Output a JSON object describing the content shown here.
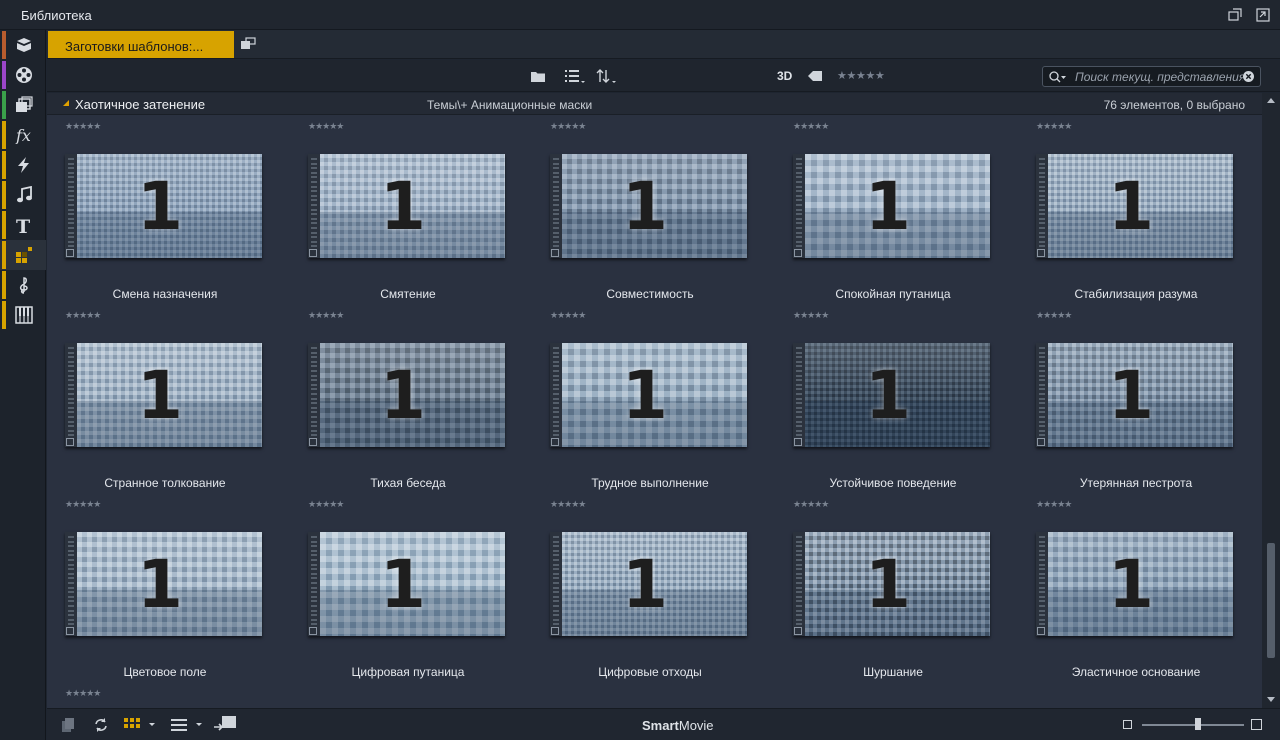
{
  "app": {
    "title": "Библиотека"
  },
  "sidebar": {
    "items": [
      {
        "icon": "box-icon",
        "color": "#b85c2e"
      },
      {
        "icon": "film-reel-icon",
        "color": "#9b46c8"
      },
      {
        "icon": "clips-stack-icon",
        "color": "#3aa04a"
      },
      {
        "icon": "fx-icon",
        "color": "#d7a300"
      },
      {
        "icon": "transition-bolt-icon",
        "color": "#d7a300"
      },
      {
        "icon": "music-note-icon",
        "color": "#d7a300"
      },
      {
        "icon": "title-text-icon",
        "color": "#d7a300"
      },
      {
        "icon": "template-grid-icon",
        "color": "#d7a300",
        "active": true
      },
      {
        "icon": "treble-clef-icon",
        "color": "#d7a300"
      },
      {
        "icon": "piano-icon",
        "color": "#d7a300"
      }
    ]
  },
  "tab": {
    "label": "Заготовки шаблонов:..."
  },
  "toolbar": {
    "label_3d": "3D",
    "search_placeholder": "Поиск текущ. представления",
    "rating_filter": "0 of 5 stars"
  },
  "group": {
    "name": "Хаотичное затенение",
    "path": "Темы\\+ Анимационные маски",
    "count": "76 элементов, 0 выбрано"
  },
  "items": [
    {
      "title": "Смена назначения",
      "rating": 0
    },
    {
      "title": "Смятение",
      "rating": 0
    },
    {
      "title": "Совместимость",
      "rating": 0
    },
    {
      "title": "Спокойная путаница",
      "rating": 0
    },
    {
      "title": "Стабилизация разума",
      "rating": 0
    },
    {
      "title": "Странное толкование",
      "rating": 0
    },
    {
      "title": "Тихая беседа",
      "rating": 0
    },
    {
      "title": "Трудное выполнение",
      "rating": 0
    },
    {
      "title": "Устойчивое поведение",
      "rating": 0
    },
    {
      "title": "Утерянная пестрота",
      "rating": 0
    },
    {
      "title": "Цветовое поле",
      "rating": 0
    },
    {
      "title": "Цифровая путаница",
      "rating": 0
    },
    {
      "title": "Цифровые отходы",
      "rating": 0
    },
    {
      "title": "Шуршание",
      "rating": 0
    },
    {
      "title": "Эластичное основание",
      "rating": 0
    }
  ],
  "thumb_number": "1",
  "status": {
    "brand_bold": "Smart",
    "brand_rest": "Movie",
    "zoom_level": 0.55
  },
  "colors": {
    "accent": "#d7a300",
    "background": "#2a3140"
  }
}
